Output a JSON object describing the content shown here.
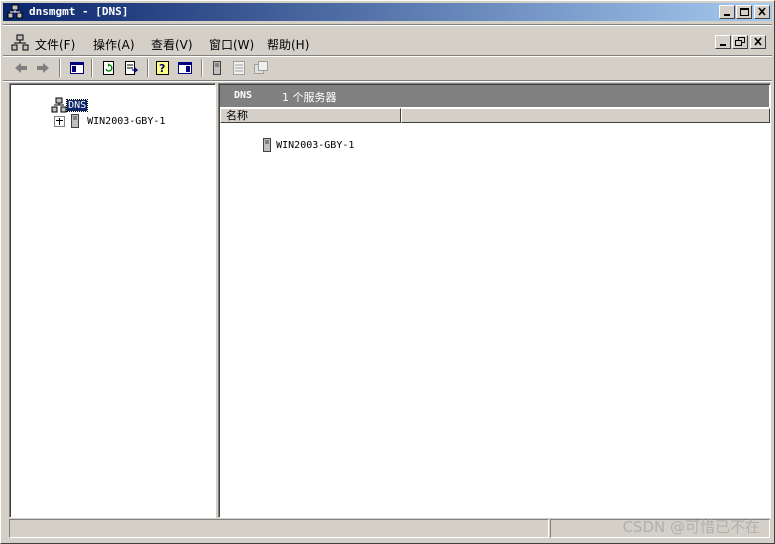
{
  "window": {
    "title": "dnsmgmt - [DNS]"
  },
  "menubar": {
    "items": [
      {
        "label": "文件(F)"
      },
      {
        "label": "操作(A)"
      },
      {
        "label": "查看(V)"
      },
      {
        "label": "窗口(W)"
      },
      {
        "label": "帮助(H)"
      }
    ]
  },
  "toolbar": {
    "buttons": [
      "back-icon",
      "forward-icon",
      "show-hide-tree-icon",
      "refresh-icon",
      "export-list-icon",
      "help-icon",
      "action-pane-icon",
      "server-icon",
      "properties-icon",
      "new-window-icon"
    ]
  },
  "tree": {
    "root": {
      "label": "DNS"
    },
    "children": [
      {
        "label": "WIN2003-GBY-1",
        "expander": "⊞"
      }
    ]
  },
  "detail": {
    "header_title": "DNS",
    "header_subtitle": "1 个服务器",
    "columns": [
      "名称",
      ""
    ],
    "rows": [
      {
        "name": "WIN2003-GBY-1"
      }
    ]
  },
  "watermark": "CSDN @可惜已不在",
  "colors": {
    "titlebar_start": "#0a246a",
    "titlebar_end": "#a6caf0",
    "chrome": "#d4d0c8",
    "header_band": "#808080",
    "selection": "#0a246a"
  }
}
